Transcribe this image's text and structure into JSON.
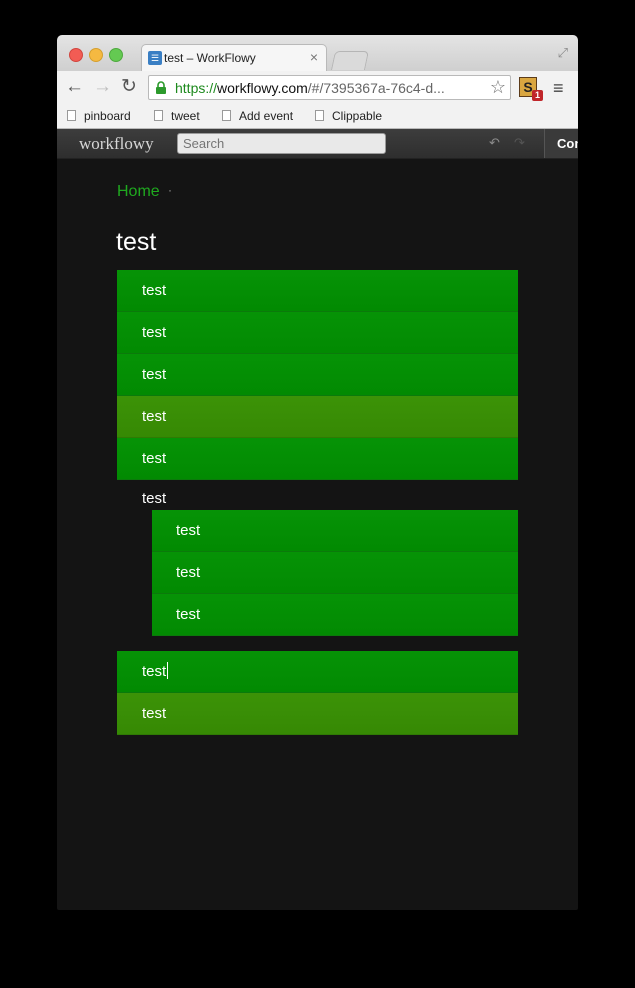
{
  "browser": {
    "tab_title": "test – WorkFlowy",
    "tab_close_glyph": "×",
    "url_protocol": "https://",
    "url_host": "workflowy.com",
    "url_path": "/#/7395367a-76c4-d...",
    "extension_letter": "S",
    "extension_badge": "1",
    "bookmarks": [
      "pinboard",
      "tweet",
      "Add event",
      "Clippable"
    ]
  },
  "app": {
    "logo": "workflowy",
    "search_placeholder": "Search",
    "complete_label": "Complete"
  },
  "breadcrumb": {
    "home": "Home",
    "separator": "·"
  },
  "page_title": "test",
  "items": [
    {
      "label": "test",
      "style": "green"
    },
    {
      "label": "test",
      "style": "green"
    },
    {
      "label": "test",
      "style": "green"
    },
    {
      "label": "test",
      "style": "olive"
    },
    {
      "label": "test",
      "style": "green"
    }
  ],
  "parent_item": {
    "label": "test"
  },
  "children": [
    {
      "label": "test"
    },
    {
      "label": "test"
    },
    {
      "label": "test"
    }
  ],
  "bottom_items": [
    {
      "label": "test",
      "style": "green",
      "editing": true
    },
    {
      "label": "test",
      "style": "olive"
    }
  ],
  "colors": {
    "accent_green": "#049004",
    "selected_olive": "#3a9006",
    "background": "#141414"
  }
}
